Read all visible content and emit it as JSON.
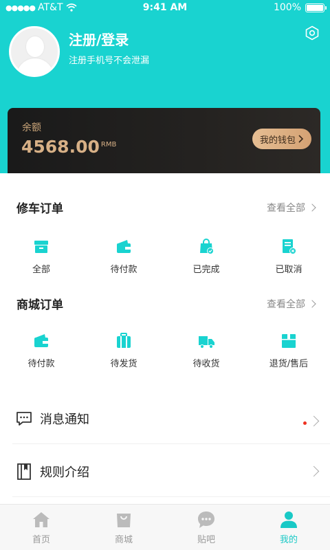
{
  "status_bar": {
    "carrier": "AT&T",
    "time": "9:41 AM",
    "battery": "100%"
  },
  "profile": {
    "name": "注册/登录",
    "subtitle": "注册手机号不会泄漏"
  },
  "wallet": {
    "label": "余额",
    "amount": "4568.00",
    "unit": "RMB",
    "button": "我的钱包"
  },
  "repair_orders": {
    "title": "修车订单",
    "view_all": "查看全部",
    "items": [
      {
        "label": "全部",
        "icon": "box-icon"
      },
      {
        "label": "待付款",
        "icon": "wallet-icon"
      },
      {
        "label": "已完成",
        "icon": "bag-check-icon"
      },
      {
        "label": "已取消",
        "icon": "receipt-cancel-icon"
      }
    ]
  },
  "mall_orders": {
    "title": "商城订单",
    "view_all": "查看全部",
    "items": [
      {
        "label": "待付款",
        "icon": "wallet-icon"
      },
      {
        "label": "待发货",
        "icon": "suitcase-icon"
      },
      {
        "label": "待收货",
        "icon": "truck-icon"
      },
      {
        "label": "退货/售后",
        "icon": "return-box-icon"
      }
    ]
  },
  "menu": [
    {
      "label": "消息通知",
      "icon": "message-icon",
      "has_badge": true
    },
    {
      "label": "规则介绍",
      "icon": "book-icon",
      "has_badge": false
    }
  ],
  "tabbar": [
    {
      "label": "首页",
      "icon": "home-icon",
      "active": false
    },
    {
      "label": "商城",
      "icon": "shopping-bag-icon",
      "active": false
    },
    {
      "label": "贴吧",
      "icon": "chat-bubble-icon",
      "active": false
    },
    {
      "label": "我的",
      "icon": "profile-icon",
      "active": true
    }
  ],
  "colors": {
    "accent": "#19d3d0",
    "gold": "#d7b086",
    "badge": "#ee3322",
    "inactive": "#bbbbbb"
  }
}
